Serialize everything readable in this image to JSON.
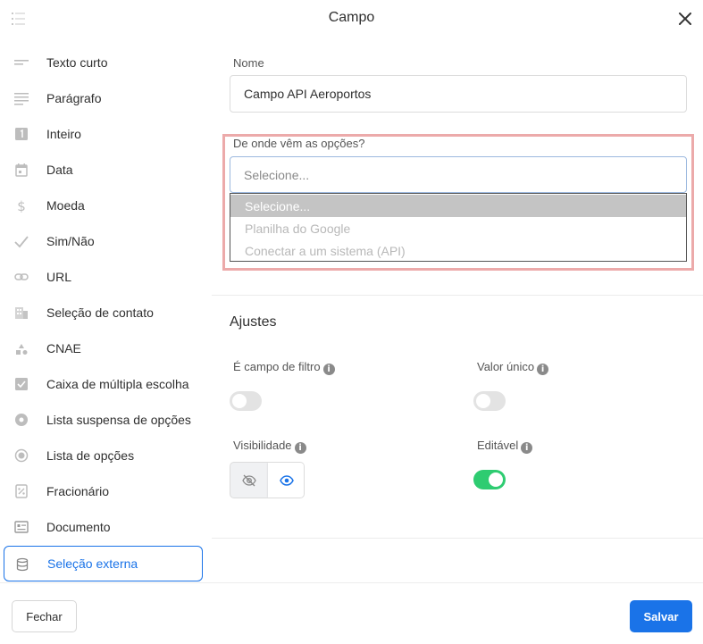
{
  "header": {
    "title": "Campo"
  },
  "sidebar": {
    "items": [
      {
        "label": "Texto curto",
        "icon": "short-text-icon"
      },
      {
        "label": "Parágrafo",
        "icon": "paragraph-icon"
      },
      {
        "label": "Inteiro",
        "icon": "integer-icon"
      },
      {
        "label": "Data",
        "icon": "calendar-icon"
      },
      {
        "label": "Moeda",
        "icon": "dollar-icon"
      },
      {
        "label": "Sim/Não",
        "icon": "check-icon"
      },
      {
        "label": "URL",
        "icon": "link-icon"
      },
      {
        "label": "Seleção de contato",
        "icon": "building-icon"
      },
      {
        "label": "CNAE",
        "icon": "shapes-icon"
      },
      {
        "label": "Caixa de múltipla escolha",
        "icon": "checkbox-icon"
      },
      {
        "label": "Lista suspensa de opções",
        "icon": "dropdown-icon"
      },
      {
        "label": "Lista de opções",
        "icon": "radio-icon"
      },
      {
        "label": "Fracionário",
        "icon": "percent-icon"
      },
      {
        "label": "Documento",
        "icon": "document-icon"
      },
      {
        "label": "Seleção externa",
        "icon": "database-icon",
        "active": true
      }
    ]
  },
  "form": {
    "name_label": "Nome",
    "name_value": "Campo API Aeroportos",
    "source_label": "De onde vêm as opções?",
    "source_placeholder": "Selecione...",
    "source_options": [
      "Selecione...",
      "Planilha do Google",
      "Conectar a um sistema (API)"
    ]
  },
  "settings": {
    "title": "Ajustes",
    "filter_label": "É campo de filtro",
    "filter_on": false,
    "unique_label": "Valor único",
    "unique_on": false,
    "visibility_label": "Visibilidade",
    "visibility_selected": "visible",
    "editable_label": "Editável",
    "editable_on": true
  },
  "footer": {
    "close_label": "Fechar",
    "save_label": "Salvar"
  },
  "colors": {
    "accent": "#1a73e8",
    "toggle_on": "#2ecc71",
    "highlight_border": "#ecaaaa"
  }
}
